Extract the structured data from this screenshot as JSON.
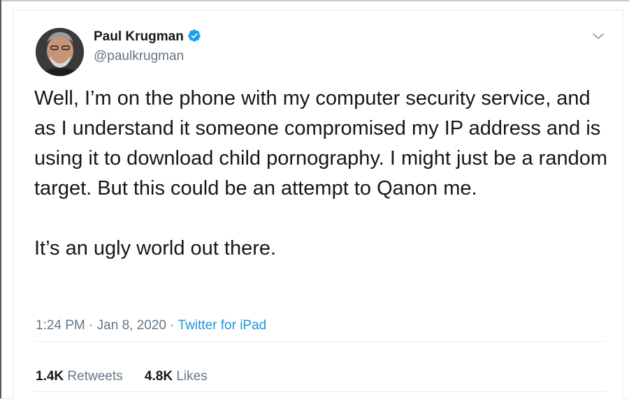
{
  "author": {
    "name": "Paul Krugman",
    "handle": "@paulkrugman",
    "verified": true
  },
  "tweet": {
    "paragraphs": [
      "Well, I’m on the phone with my computer security service, and as I understand it someone compromised my IP address and is using it to download child pornography. I might just be a random target. But this could be an attempt to Qanon me.",
      "It’s an ugly world out there."
    ],
    "time": "1:24 PM",
    "date": "Jan 8, 2020",
    "separator": "·",
    "source": "Twitter for iPad"
  },
  "stats": {
    "retweets_count": "1.4K",
    "retweets_label": "Retweets",
    "likes_count": "4.8K",
    "likes_label": "Likes"
  },
  "icons": {
    "verified": "verified-badge-icon",
    "menu": "chevron-down-icon"
  },
  "colors": {
    "link": "#1b95e0",
    "text": "#14171a",
    "secondary": "#657786",
    "divider": "#e6ecf0"
  }
}
